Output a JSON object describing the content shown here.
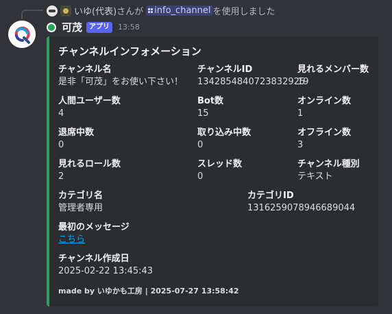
{
  "reply": {
    "user": "いゆ(代表)",
    "text_before": "さんが",
    "command": "info_channel",
    "text_after": "を使用しました"
  },
  "message": {
    "username": "可茂",
    "app_tag": "アプリ",
    "timestamp": "13:58"
  },
  "embed": {
    "title": "チャンネルインフォメーション",
    "accent_color": "#23a55a",
    "fields": [
      {
        "name": "チャンネル名",
        "value": "是非「可茂」をお使い下さい！"
      },
      {
        "name": "チャンネルID",
        "value": "1342854840723832925"
      },
      {
        "name": "見れるメンバー数",
        "value": "19"
      },
      {
        "name": "人間ユーザー数",
        "value": "4"
      },
      {
        "name": "Bot数",
        "value": "15"
      },
      {
        "name": "オンライン数",
        "value": "1"
      },
      {
        "name": "退席中数",
        "value": "0"
      },
      {
        "name": "取り込み中数",
        "value": "0"
      },
      {
        "name": "オフライン数",
        "value": "3"
      },
      {
        "name": "見れるロール数",
        "value": "2"
      },
      {
        "name": "スレッド数",
        "value": "0"
      },
      {
        "name": "チャンネル種別",
        "value": "テキスト"
      },
      {
        "name": "カテゴリ名",
        "value": "管理者専用"
      },
      {
        "name": "カテゴリID",
        "value": "1316259078946689044"
      },
      {
        "name": "最初のメッセージ",
        "value": "こちら"
      },
      {
        "name": "チャンネル作成日",
        "value": "2025-02-22 13:45:43"
      }
    ],
    "footer": "made by いゆかも工房 | 2025-07-27 13:58:42"
  }
}
